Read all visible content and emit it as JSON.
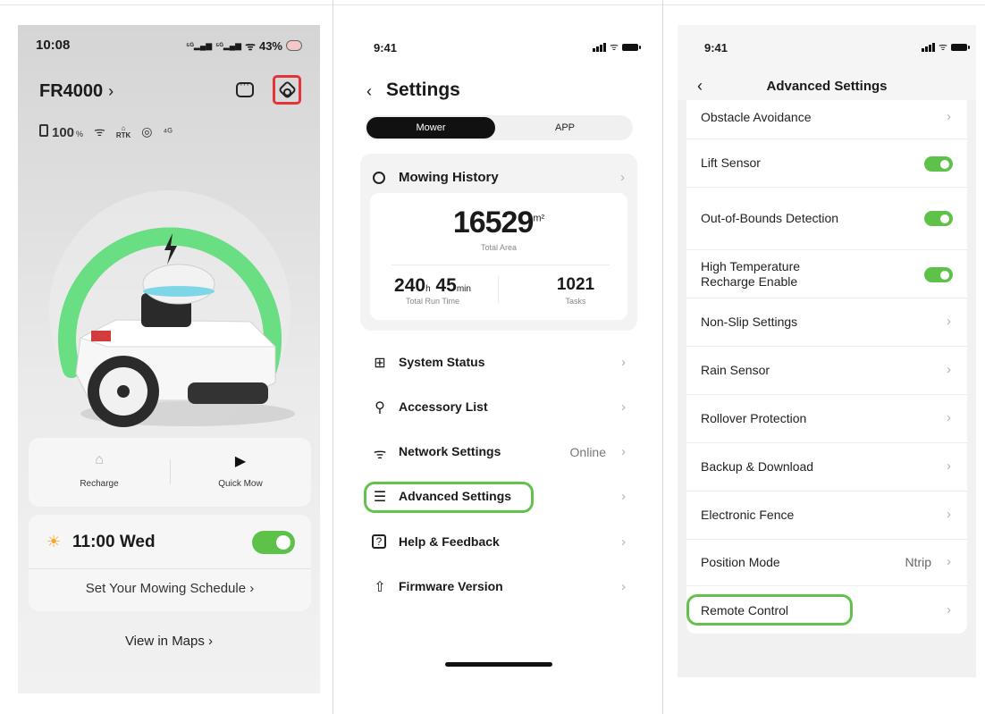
{
  "phone1": {
    "status_time": "10:08",
    "status_battery": "43%",
    "device_name": "FR4000",
    "battery_value": "100",
    "battery_unit": "%",
    "rtk_label": "RTK",
    "actions": [
      {
        "label": "Recharge",
        "icon": "recharge-icon"
      },
      {
        "label": "Quick Mow",
        "icon": "play-icon"
      }
    ],
    "schedule_time": "11:00 Wed",
    "schedule_enabled": true,
    "schedule_link": "Set Your Mowing Schedule",
    "maps_link": "View in Maps",
    "arc_color": "#5ee07a",
    "highlight_color": "#e5333a"
  },
  "phone2": {
    "status_time": "9:41",
    "title": "Settings",
    "tabs": [
      "Mower",
      "APP"
    ],
    "history_title": "Mowing History",
    "total_area": "16529",
    "area_unit": "m²",
    "total_area_label": "Total Area",
    "run_hours": "240",
    "run_minutes": "45",
    "hours_unit": "h",
    "minutes_unit": "min",
    "run_time_label": "Total Run Time",
    "tasks": "1021",
    "tasks_label": "Tasks",
    "menu": [
      {
        "label": "System Status",
        "icon": "grid-icon",
        "value": ""
      },
      {
        "label": "Accessory List",
        "icon": "accessory-icon",
        "value": ""
      },
      {
        "label": "Network Settings",
        "icon": "wifi-icon",
        "value": "Online"
      },
      {
        "label": "Advanced Settings",
        "icon": "sliders-icon",
        "value": ""
      },
      {
        "label": "Help & Feedback",
        "icon": "help-icon",
        "value": ""
      },
      {
        "label": "Firmware Version",
        "icon": "upload-icon",
        "value": ""
      }
    ],
    "highlight_color": "#62c24c"
  },
  "phone3": {
    "status_time": "9:41",
    "title": "Advanced Settings",
    "rows": [
      {
        "label": "Obstacle Avoidance",
        "type": "link",
        "value": ""
      },
      {
        "label": "Lift Sensor",
        "type": "toggle",
        "value": ""
      },
      {
        "label": "Out-of-Bounds Detection",
        "type": "toggle",
        "value": ""
      },
      {
        "label": "High Temperature",
        "label2": "Recharge Enable",
        "type": "toggle",
        "value": ""
      },
      {
        "label": "Non-Slip Settings",
        "type": "link",
        "value": ""
      },
      {
        "label": "Rain Sensor",
        "type": "link",
        "value": ""
      },
      {
        "label": "Rollover Protection",
        "type": "link",
        "value": ""
      },
      {
        "label": "Backup & Download",
        "type": "link",
        "value": ""
      },
      {
        "label": "Electronic Fence",
        "type": "link",
        "value": ""
      },
      {
        "label": "Position Mode",
        "type": "link",
        "value": "Ntrip"
      },
      {
        "label": "Remote Control",
        "type": "link",
        "value": ""
      }
    ],
    "toggle_color": "#5ec24a"
  }
}
